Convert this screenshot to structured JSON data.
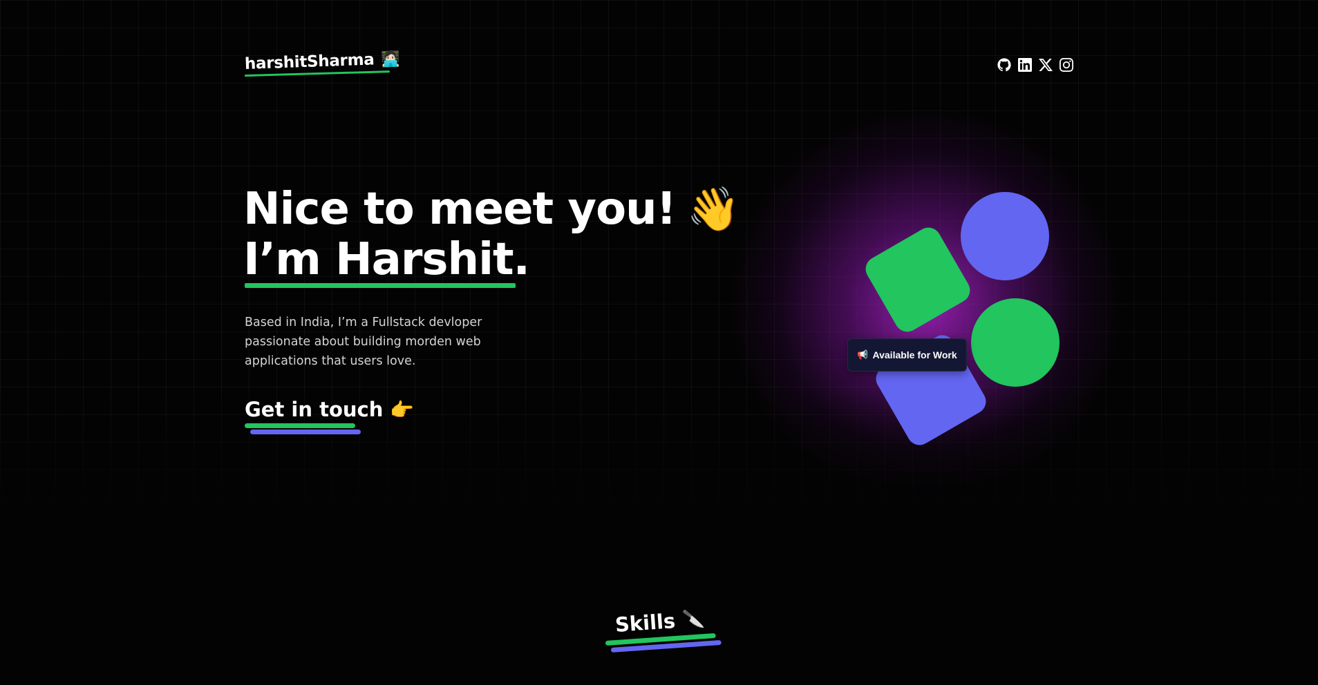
{
  "header": {
    "logo_text": "harshitSharma",
    "logo_emoji": "🧑🏻‍💻",
    "social_icons": [
      "github-icon",
      "linkedin-icon",
      "x-icon",
      "instagram-icon"
    ]
  },
  "hero": {
    "headline_line1": "Nice to meet you!",
    "headline_emoji": "👋",
    "headline_line2": "I’m Harshit.",
    "intro": "Based in India, I’m a Fullstack devloper passionate about building morden web applications that users love.",
    "cta_label": "Get in touch",
    "cta_emoji": "👉"
  },
  "badge": {
    "emoji": "📢",
    "label": "Available for Work"
  },
  "skills": {
    "heading": "Skills",
    "emoji": "🔪"
  },
  "colors": {
    "green": "#22c55e",
    "indigo": "#6366f1",
    "glow": "#a21caf",
    "background": "#030303"
  }
}
